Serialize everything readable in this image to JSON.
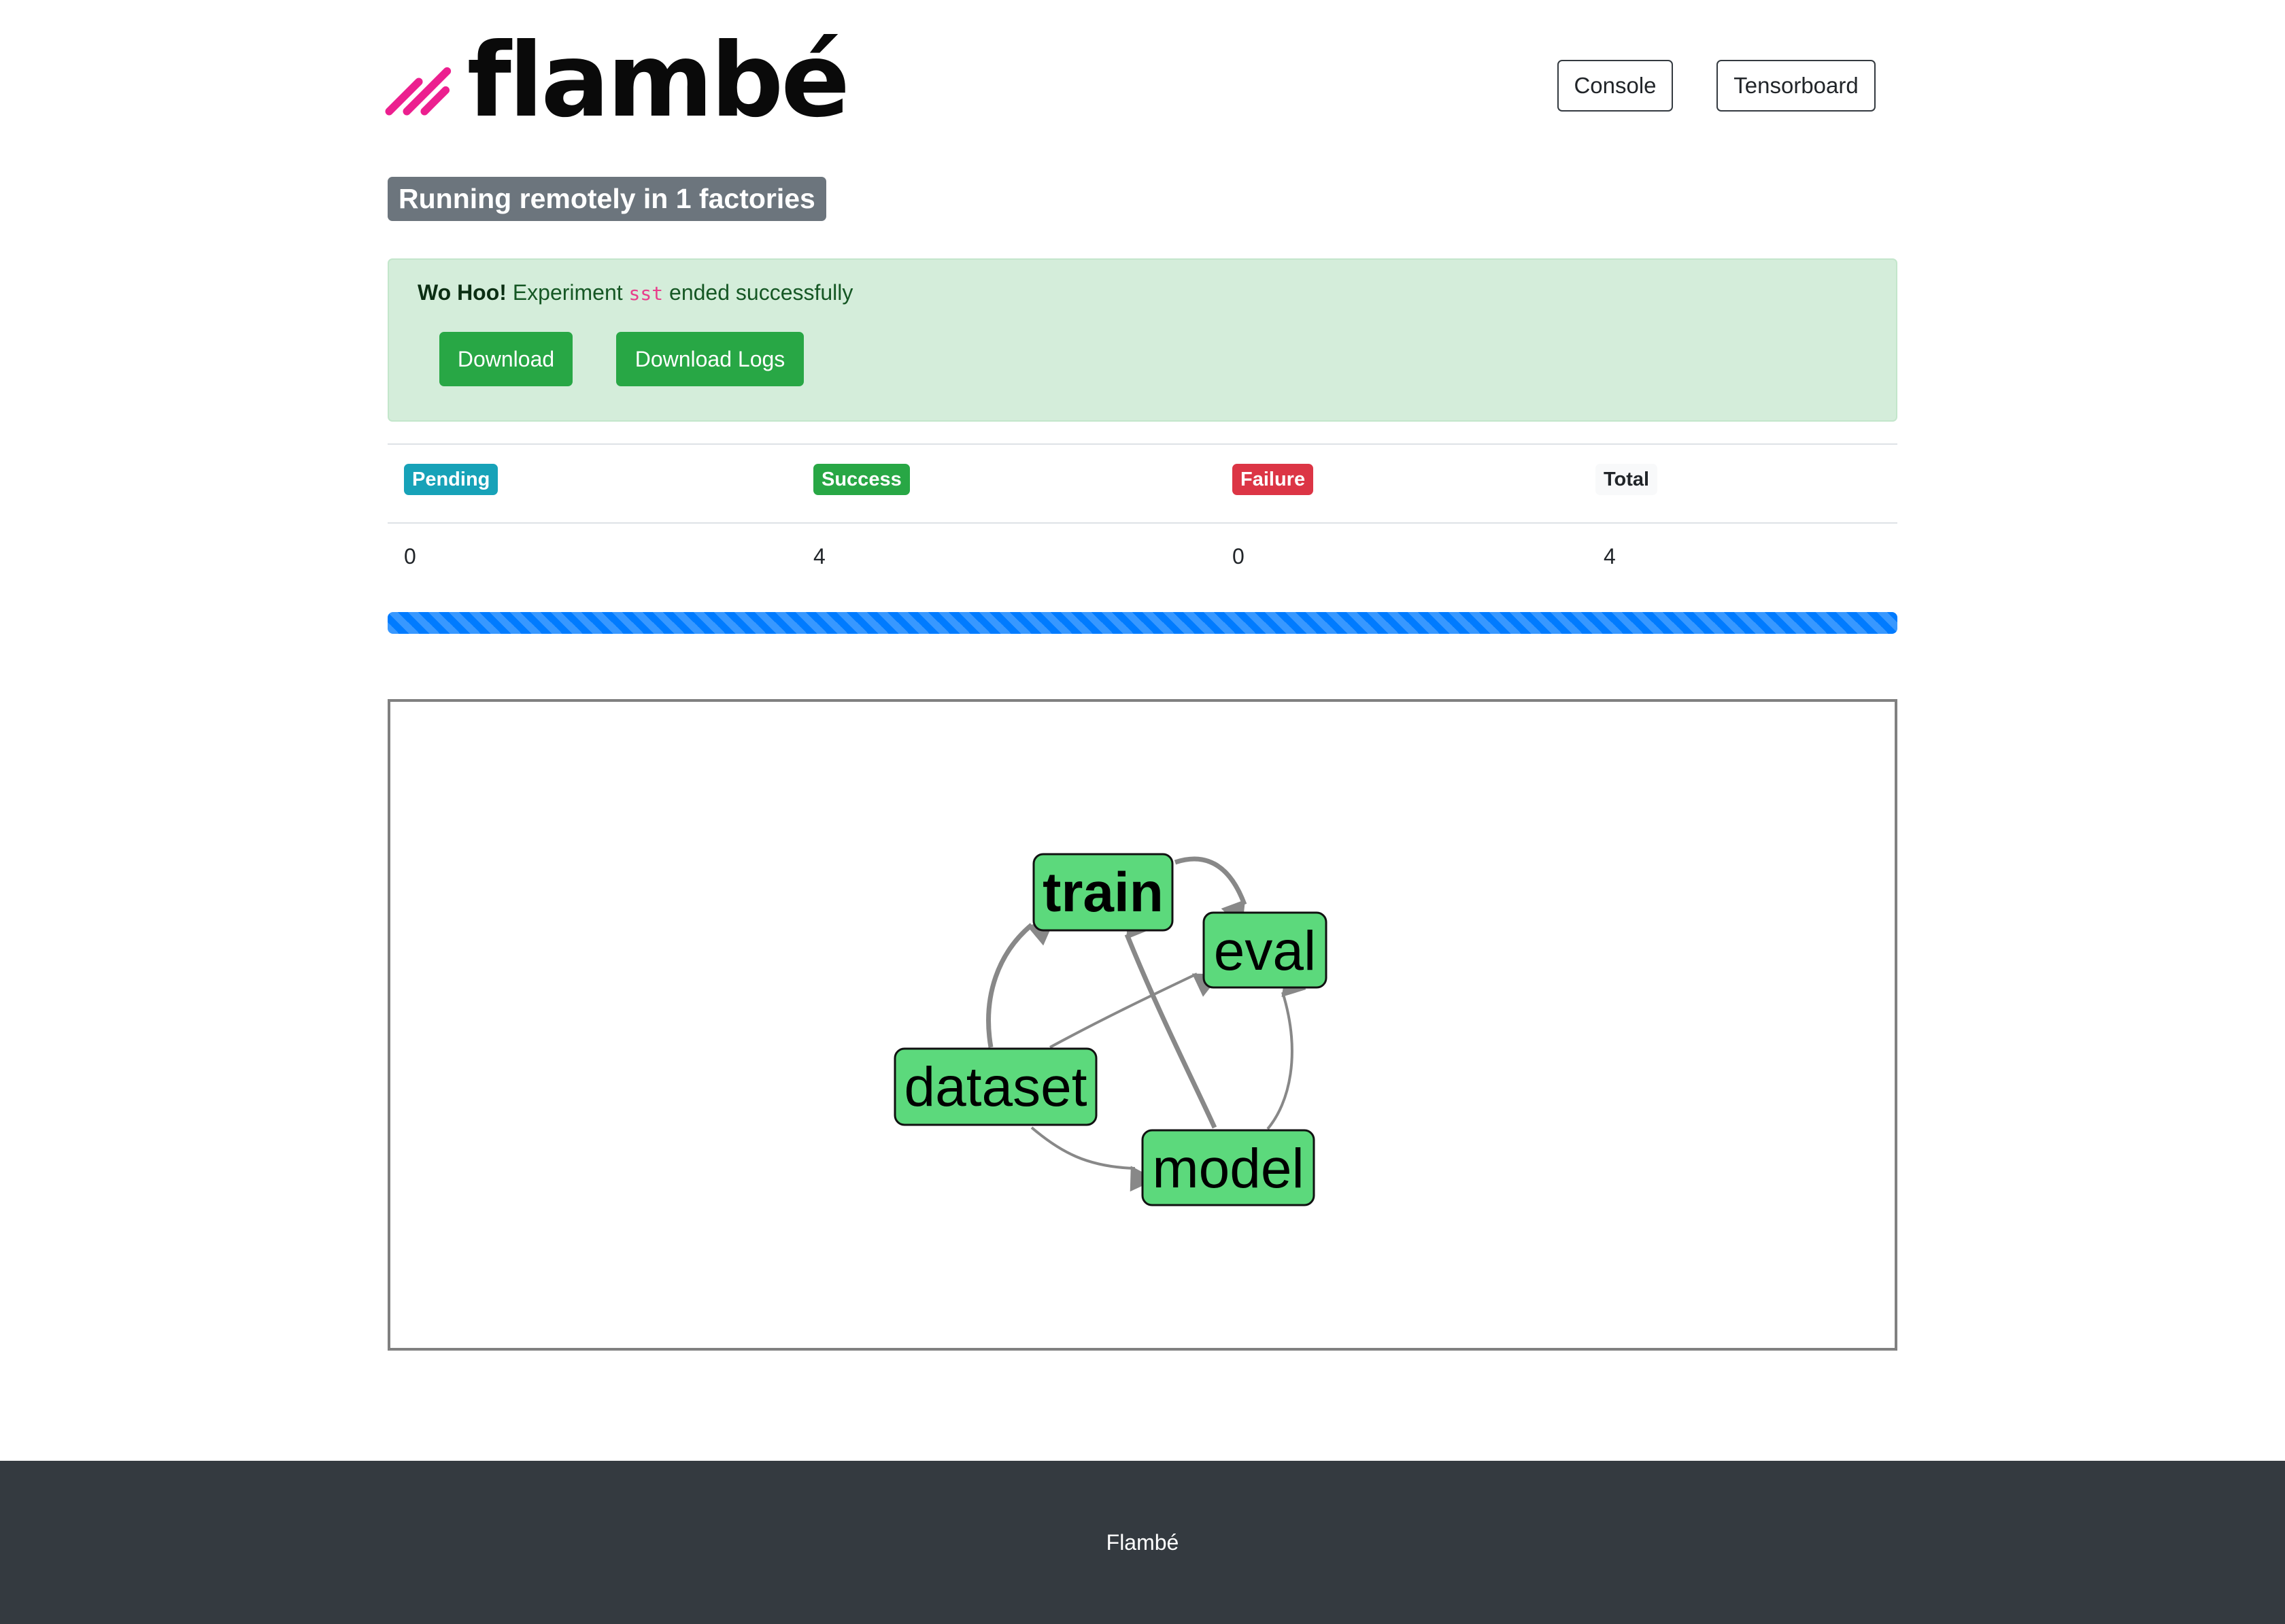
{
  "header": {
    "logo_text": "flambé",
    "nav": {
      "console_label": "Console",
      "tensorboard_label": "Tensorboard"
    },
    "status_badge": "Running remotely in 1 factories",
    "brand_color": "#ec1f8f"
  },
  "alert": {
    "strong": "Wo Hoo!",
    "before_code": " Experiment ",
    "experiment_name": "sst",
    "after_code": " ended successfully",
    "download_label": "Download",
    "download_logs_label": "Download Logs"
  },
  "stats": {
    "headers": {
      "pending": "Pending",
      "success": "Success",
      "failure": "Failure",
      "total": "Total"
    },
    "values": {
      "pending": "0",
      "success": "4",
      "failure": "0",
      "total": "4"
    },
    "colors": {
      "pending": "#17a2b8",
      "success": "#28a745",
      "failure": "#dc3545",
      "total": "#f8f9fa"
    }
  },
  "progress": {
    "fraction": 1.0,
    "striped": true,
    "color": "#007bff"
  },
  "graph": {
    "nodes": [
      {
        "id": "train",
        "label": "train",
        "bold": true
      },
      {
        "id": "eval",
        "label": "eval",
        "bold": false
      },
      {
        "id": "dataset",
        "label": "dataset",
        "bold": false
      },
      {
        "id": "model",
        "label": "model",
        "bold": false
      }
    ],
    "edges": [
      {
        "from": "train",
        "to": "eval"
      },
      {
        "from": "dataset",
        "to": "train"
      },
      {
        "from": "dataset",
        "to": "eval"
      },
      {
        "from": "dataset",
        "to": "model"
      },
      {
        "from": "model",
        "to": "train"
      },
      {
        "from": "model",
        "to": "eval"
      }
    ],
    "node_color": "#5cd97c",
    "edge_color": "#888888"
  },
  "footer": {
    "text": "Flambé"
  }
}
